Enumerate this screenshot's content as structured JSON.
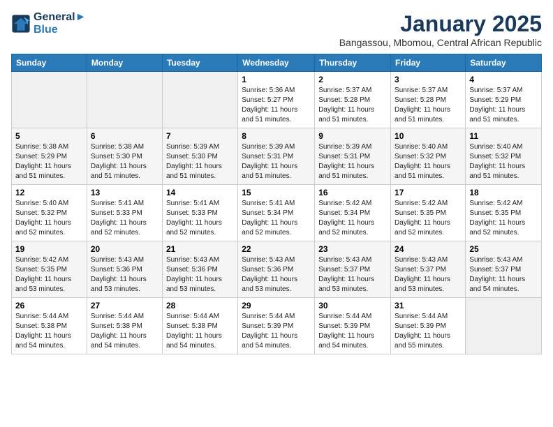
{
  "header": {
    "logo_line1": "General",
    "logo_line2": "Blue",
    "title": "January 2025",
    "subtitle": "Bangassou, Mbomou, Central African Republic"
  },
  "days_of_week": [
    "Sunday",
    "Monday",
    "Tuesday",
    "Wednesday",
    "Thursday",
    "Friday",
    "Saturday"
  ],
  "weeks": [
    [
      {
        "num": "",
        "text": ""
      },
      {
        "num": "",
        "text": ""
      },
      {
        "num": "",
        "text": ""
      },
      {
        "num": "1",
        "text": "Sunrise: 5:36 AM\nSunset: 5:27 PM\nDaylight: 11 hours and 51 minutes."
      },
      {
        "num": "2",
        "text": "Sunrise: 5:37 AM\nSunset: 5:28 PM\nDaylight: 11 hours and 51 minutes."
      },
      {
        "num": "3",
        "text": "Sunrise: 5:37 AM\nSunset: 5:28 PM\nDaylight: 11 hours and 51 minutes."
      },
      {
        "num": "4",
        "text": "Sunrise: 5:37 AM\nSunset: 5:29 PM\nDaylight: 11 hours and 51 minutes."
      }
    ],
    [
      {
        "num": "5",
        "text": "Sunrise: 5:38 AM\nSunset: 5:29 PM\nDaylight: 11 hours and 51 minutes."
      },
      {
        "num": "6",
        "text": "Sunrise: 5:38 AM\nSunset: 5:30 PM\nDaylight: 11 hours and 51 minutes."
      },
      {
        "num": "7",
        "text": "Sunrise: 5:39 AM\nSunset: 5:30 PM\nDaylight: 11 hours and 51 minutes."
      },
      {
        "num": "8",
        "text": "Sunrise: 5:39 AM\nSunset: 5:31 PM\nDaylight: 11 hours and 51 minutes."
      },
      {
        "num": "9",
        "text": "Sunrise: 5:39 AM\nSunset: 5:31 PM\nDaylight: 11 hours and 51 minutes."
      },
      {
        "num": "10",
        "text": "Sunrise: 5:40 AM\nSunset: 5:32 PM\nDaylight: 11 hours and 51 minutes."
      },
      {
        "num": "11",
        "text": "Sunrise: 5:40 AM\nSunset: 5:32 PM\nDaylight: 11 hours and 51 minutes."
      }
    ],
    [
      {
        "num": "12",
        "text": "Sunrise: 5:40 AM\nSunset: 5:32 PM\nDaylight: 11 hours and 52 minutes."
      },
      {
        "num": "13",
        "text": "Sunrise: 5:41 AM\nSunset: 5:33 PM\nDaylight: 11 hours and 52 minutes."
      },
      {
        "num": "14",
        "text": "Sunrise: 5:41 AM\nSunset: 5:33 PM\nDaylight: 11 hours and 52 minutes."
      },
      {
        "num": "15",
        "text": "Sunrise: 5:41 AM\nSunset: 5:34 PM\nDaylight: 11 hours and 52 minutes."
      },
      {
        "num": "16",
        "text": "Sunrise: 5:42 AM\nSunset: 5:34 PM\nDaylight: 11 hours and 52 minutes."
      },
      {
        "num": "17",
        "text": "Sunrise: 5:42 AM\nSunset: 5:35 PM\nDaylight: 11 hours and 52 minutes."
      },
      {
        "num": "18",
        "text": "Sunrise: 5:42 AM\nSunset: 5:35 PM\nDaylight: 11 hours and 52 minutes."
      }
    ],
    [
      {
        "num": "19",
        "text": "Sunrise: 5:42 AM\nSunset: 5:35 PM\nDaylight: 11 hours and 53 minutes."
      },
      {
        "num": "20",
        "text": "Sunrise: 5:43 AM\nSunset: 5:36 PM\nDaylight: 11 hours and 53 minutes."
      },
      {
        "num": "21",
        "text": "Sunrise: 5:43 AM\nSunset: 5:36 PM\nDaylight: 11 hours and 53 minutes."
      },
      {
        "num": "22",
        "text": "Sunrise: 5:43 AM\nSunset: 5:36 PM\nDaylight: 11 hours and 53 minutes."
      },
      {
        "num": "23",
        "text": "Sunrise: 5:43 AM\nSunset: 5:37 PM\nDaylight: 11 hours and 53 minutes."
      },
      {
        "num": "24",
        "text": "Sunrise: 5:43 AM\nSunset: 5:37 PM\nDaylight: 11 hours and 53 minutes."
      },
      {
        "num": "25",
        "text": "Sunrise: 5:43 AM\nSunset: 5:37 PM\nDaylight: 11 hours and 54 minutes."
      }
    ],
    [
      {
        "num": "26",
        "text": "Sunrise: 5:44 AM\nSunset: 5:38 PM\nDaylight: 11 hours and 54 minutes."
      },
      {
        "num": "27",
        "text": "Sunrise: 5:44 AM\nSunset: 5:38 PM\nDaylight: 11 hours and 54 minutes."
      },
      {
        "num": "28",
        "text": "Sunrise: 5:44 AM\nSunset: 5:38 PM\nDaylight: 11 hours and 54 minutes."
      },
      {
        "num": "29",
        "text": "Sunrise: 5:44 AM\nSunset: 5:39 PM\nDaylight: 11 hours and 54 minutes."
      },
      {
        "num": "30",
        "text": "Sunrise: 5:44 AM\nSunset: 5:39 PM\nDaylight: 11 hours and 54 minutes."
      },
      {
        "num": "31",
        "text": "Sunrise: 5:44 AM\nSunset: 5:39 PM\nDaylight: 11 hours and 55 minutes."
      },
      {
        "num": "",
        "text": ""
      }
    ]
  ]
}
